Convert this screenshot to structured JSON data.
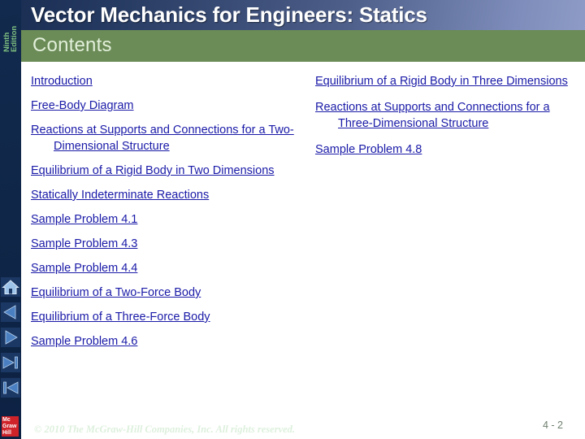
{
  "sidebar": {
    "edition_label": "Ninth\nEdition",
    "edition_color": "#7fbf7f",
    "background_color": "#11284b",
    "nav_buttons": [
      {
        "name": "home-icon",
        "label": "Home"
      },
      {
        "name": "previous-icon",
        "label": "Previous"
      },
      {
        "name": "next-icon",
        "label": "Next"
      },
      {
        "name": "last-slide-icon",
        "label": "Last"
      },
      {
        "name": "first-slide-icon",
        "label": "First"
      }
    ],
    "logo": {
      "line1": "Mc",
      "line2": "Graw",
      "line3": "Hill",
      "color": "#cf2229"
    }
  },
  "header": {
    "title": "Vector Mechanics for Engineers: Statics",
    "subtitle": "Contents",
    "title_color": "#ffffff",
    "subtitle_bar_color": "#6b8b57",
    "subtitle_text_color": "#e2f0da"
  },
  "contents": {
    "link_color": "#1a1aa8",
    "left_column": [
      {
        "label": "Introduction",
        "wrapped": false
      },
      {
        "label": "Free-Body Diagram",
        "wrapped": false
      },
      {
        "label": "Reactions at Supports and Connections for a Two-Dimensional Structure",
        "wrapped": true
      },
      {
        "label": "Equilibrium of a Rigid Body in Two Dimensions",
        "wrapped": true
      },
      {
        "label": "Statically Indeterminate Reactions",
        "wrapped": false
      },
      {
        "label": "Sample Problem 4.1",
        "wrapped": false
      },
      {
        "label": "Sample Problem 4.3",
        "wrapped": false
      },
      {
        "label": "Sample Problem 4.4",
        "wrapped": false
      },
      {
        "label": "Equilibrium of a Two-Force Body",
        "wrapped": false
      },
      {
        "label": "Equilibrium of a Three-Force Body",
        "wrapped": false
      },
      {
        "label": "Sample Problem 4.6",
        "wrapped": false
      }
    ],
    "right_column": [
      {
        "label": "Equilibrium of a Rigid Body in Three Dimensions",
        "wrapped": true
      },
      {
        "label": "Reactions at Supports and Connections for a Three-Dimensional Structure",
        "wrapped": true
      },
      {
        "label": "Sample Problem 4.8",
        "wrapped": false
      }
    ]
  },
  "footer": {
    "copyright": "© 2010 The McGraw-Hill Companies, Inc. All rights reserved.",
    "page_number": "4 - 2"
  }
}
